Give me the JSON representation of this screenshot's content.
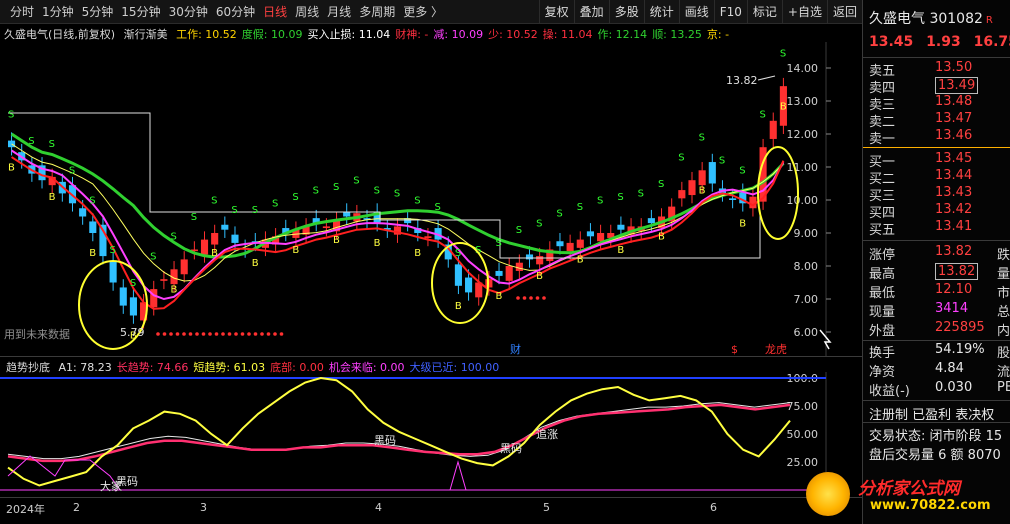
{
  "toolbar": {
    "periods": [
      "分时",
      "1分钟",
      "5分钟",
      "15分钟",
      "30分钟",
      "60分钟",
      "日线",
      "周线",
      "月线",
      "多周期",
      "更多 〉"
    ],
    "active_period": "日线",
    "actions": [
      "复权",
      "叠加",
      "多股",
      "统计",
      "画线",
      "F10",
      "标记",
      "+自选",
      "返回"
    ]
  },
  "main_chart": {
    "title": "久盛电气(日线,前复权)",
    "indicator_name": "渐行渐美",
    "items": [
      {
        "label": "工作: 10.52",
        "color": "#ffd400"
      },
      {
        "label": "度假: 10.09",
        "color": "#30d030"
      },
      {
        "label": "买入止损: 11.04",
        "color": "#ffffff"
      },
      {
        "label": "财神: -",
        "color": "#ff3040"
      },
      {
        "label": "减: 10.09",
        "color": "#ff40ff"
      },
      {
        "label": "少: 10.52",
        "color": "#ff3040"
      },
      {
        "label": "操: 11.04",
        "color": "#ff3040"
      },
      {
        "label": "作: 12.14",
        "color": "#30d030"
      },
      {
        "label": "顺: 13.25",
        "color": "#30d030"
      },
      {
        "label": "京: -",
        "color": "#ffd400"
      }
    ],
    "y_ticks": [
      "14.00",
      "13.00",
      "12.00",
      "11.00",
      "10.00",
      "9.00",
      "8.00",
      "7.00",
      "6.00"
    ],
    "high_label": "13.82",
    "low_label": "5.79",
    "future_data_label": "用到未来数据",
    "markers": {
      "cai": "财",
      "dollar": "$",
      "longhu": "龙虎"
    }
  },
  "sub_chart": {
    "title": "趋势抄底",
    "items": [
      {
        "label": "A1: 78.23",
        "color": "#e0e0e0"
      },
      {
        "label": "长趋势: 74.66",
        "color": "#ff3060"
      },
      {
        "label": "短趋势: 61.03",
        "color": "#ffff40"
      },
      {
        "label": "底部: 0.00",
        "color": "#ff3040"
      },
      {
        "label": "机会来临: 0.00",
        "color": "#ff40ff"
      },
      {
        "label": "大级已近: 100.00",
        "color": "#4060ff"
      }
    ],
    "y_ticks": [
      "100.0",
      "75.00",
      "50.00",
      "25.00"
    ],
    "annotations": [
      "黑码",
      "黑码",
      "追涨",
      "大家",
      "黑码"
    ]
  },
  "x_axis": {
    "labels": [
      "2024年",
      "2",
      "3",
      "4",
      "5",
      "6"
    ]
  },
  "panel": {
    "name": "久盛电气",
    "code": "301082",
    "r_badge": "R",
    "price": "13.45",
    "change": "1.93",
    "change_pct": "16.75%",
    "asks": [
      {
        "label": "卖五",
        "value": "13.50"
      },
      {
        "label": "卖四",
        "value": "13.49"
      },
      {
        "label": "卖三",
        "value": "13.48"
      },
      {
        "label": "卖二",
        "value": "13.47"
      },
      {
        "label": "卖一",
        "value": "13.46"
      }
    ],
    "bids": [
      {
        "label": "买一",
        "value": "13.45"
      },
      {
        "label": "买二",
        "value": "13.44"
      },
      {
        "label": "买三",
        "value": "13.43"
      },
      {
        "label": "买四",
        "value": "13.42"
      },
      {
        "label": "买五",
        "value": "13.41"
      }
    ],
    "quotes": [
      {
        "label": "涨停",
        "value": "13.82",
        "color": "#ff4040",
        "extra": "跌停"
      },
      {
        "label": "最高",
        "value": "13.82",
        "color": "#ff4040",
        "extra": "量比"
      },
      {
        "label": "最低",
        "value": "12.10",
        "color": "#ff4040",
        "extra": "市值"
      },
      {
        "label": "现量",
        "value": "3414",
        "color": "#ff40ff",
        "extra": "总股"
      },
      {
        "label": "外盘",
        "value": "225895",
        "color": "#ff4040",
        "extra": "内盘"
      }
    ],
    "stats": [
      {
        "label": "换手",
        "value": "54.19%",
        "color": "#e8e8e8",
        "extra": "股本"
      },
      {
        "label": "净资",
        "value": "4.84",
        "color": "#e8e8e8",
        "extra": "流通"
      },
      {
        "label": "收益(-)",
        "value": "0.030",
        "color": "#e8e8e8",
        "extra": "PE"
      }
    ],
    "tags": "注册制 已盈利 表决权",
    "status": "交易状态: 闭市阶段 15",
    "after_hours": "盘后交易量 6 额 8070"
  },
  "watermark": {
    "text": "分析家公式网",
    "url": "www.70822.com"
  }
}
